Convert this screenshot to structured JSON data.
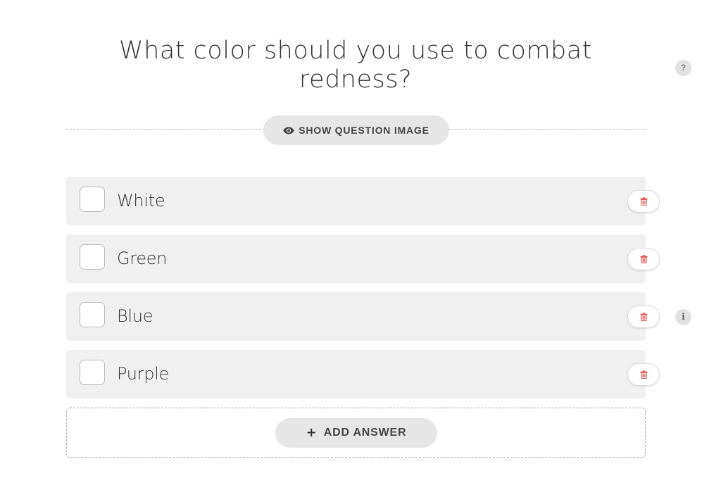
{
  "question": {
    "title": "What color should you use to combat redness?"
  },
  "help_button": {
    "label": "?"
  },
  "show_image_button": {
    "label": "SHOW QUESTION IMAGE",
    "icon": "eye-icon"
  },
  "answers": [
    {
      "text": "White",
      "checked": false
    },
    {
      "text": "Green",
      "checked": false
    },
    {
      "text": "Blue",
      "checked": false
    },
    {
      "text": "Purple",
      "checked": false
    }
  ],
  "delete_button": {
    "icon": "trash-icon",
    "color": "#e05a5a"
  },
  "info_button": {
    "label": "i"
  },
  "add_answer_button": {
    "label": "ADD ANSWER",
    "icon_glyph": "+"
  }
}
